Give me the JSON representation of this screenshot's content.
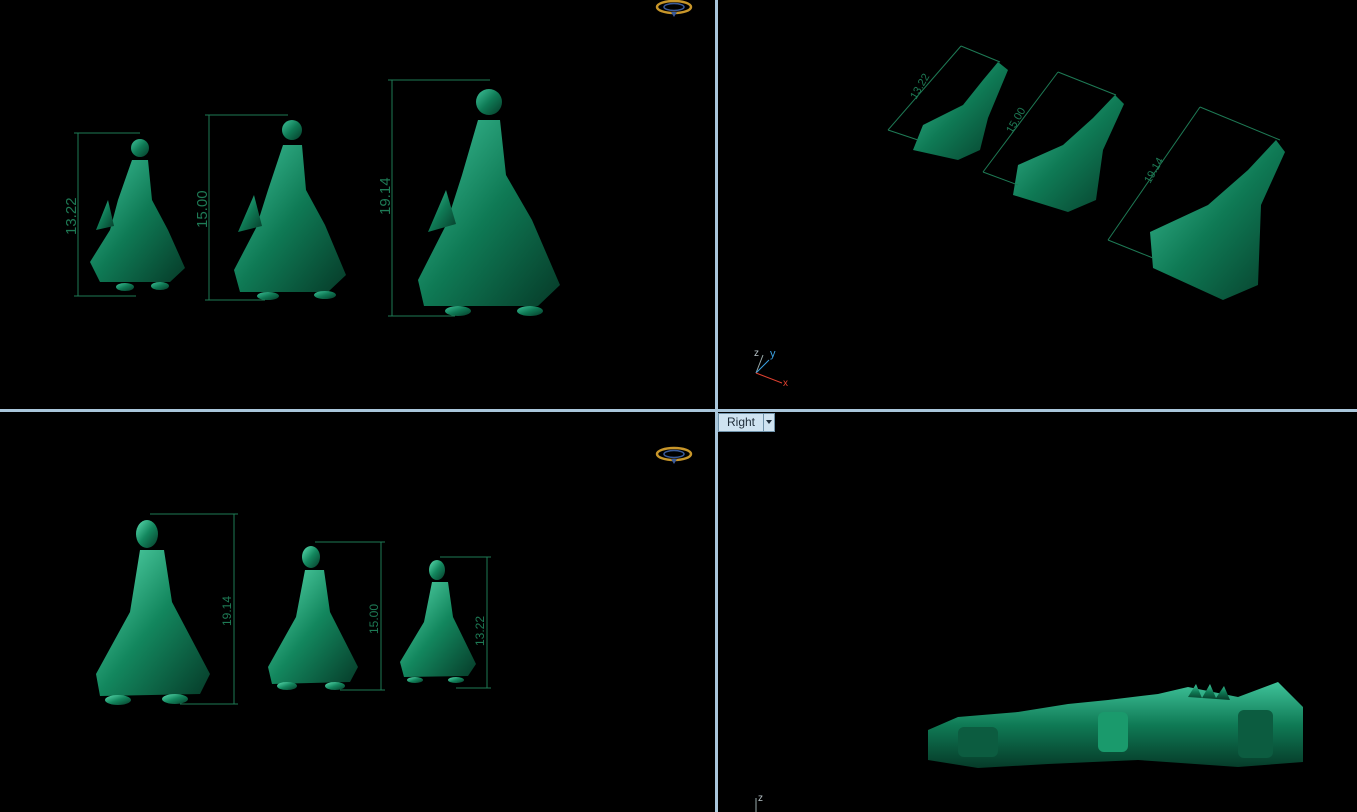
{
  "viewports": {
    "top_left": {
      "dimensions": [
        "13.22",
        "15.00",
        "19.14"
      ],
      "gumball_icon": "navigation-ring-icon"
    },
    "top_right": {
      "dimensions": [
        "13.22",
        "15.00",
        "19.14"
      ],
      "axes": {
        "z": "z",
        "y": "y",
        "x": "x"
      }
    },
    "bottom_left": {
      "dimensions": [
        "19.14",
        "15.00",
        "13.22"
      ],
      "gumball_icon": "navigation-ring-icon"
    },
    "bottom_right": {
      "label": "Right",
      "axes": {
        "z": "z"
      }
    }
  },
  "colors": {
    "model": "#0f6b4c",
    "model_highlight": "#3fc39a",
    "dimension_line": "#1e7a55",
    "divider": "#a9c6db",
    "axis_x": "#e04030",
    "axis_y": "#3aa0e0"
  }
}
